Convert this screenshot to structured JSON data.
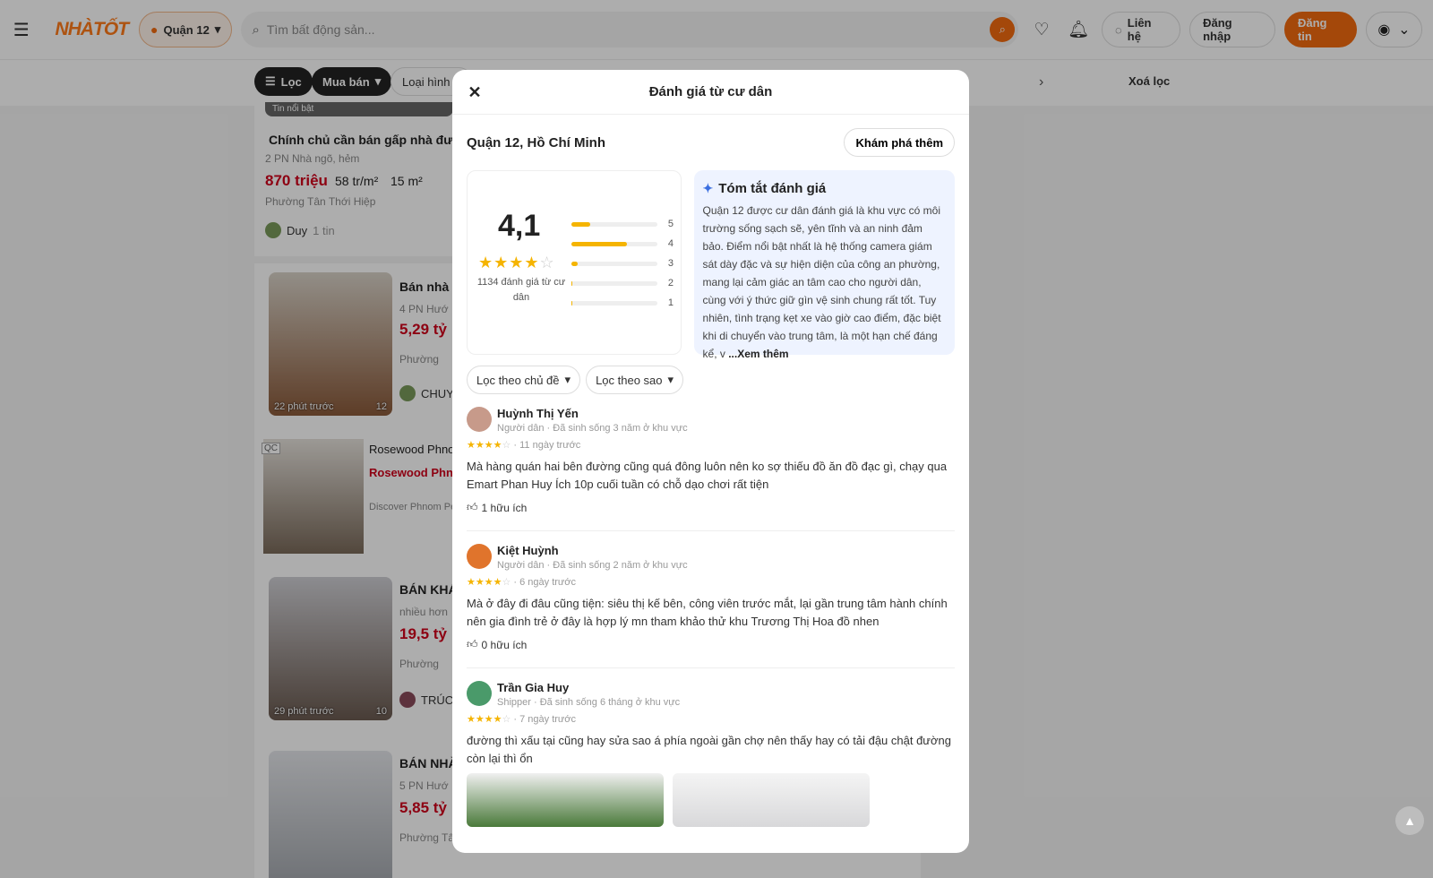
{
  "header": {
    "logo": "NHÀTỐT",
    "location": "Quận 12",
    "search_placeholder": "Tìm bất động sản...",
    "contact": "Liên hệ",
    "login": "Đăng nhập",
    "post": "Đăng tin"
  },
  "filters": {
    "filter": "Lọc",
    "type": "Mua bán",
    "category": "Loại hình B",
    "clear": "Xoá lọc"
  },
  "listings": [
    {
      "badge": "Tin nổi bật",
      "title": "Chính chủ cần bán gấp nhà đường",
      "meta": "2 PN  Nhà ngõ, hẻm",
      "price": "870 triệu",
      "ppm": "58 tr/m²",
      "area": "15 m²",
      "ward": "Phường Tân Thới Hiệp",
      "seller": "Duy",
      "seller_extra": "1 tin"
    },
    {
      "title": "Bán nhà",
      "meta": "4 PN  Hướ",
      "price": "5,29 tỷ",
      "ward": "Phường",
      "seller": "CHUY",
      "time": "22 phút trước",
      "count": "12"
    },
    {
      "ad": "QC",
      "title": "Rosewood Phno",
      "subtitle": "Rosewood Phn",
      "desc": "Discover Phnom Per"
    },
    {
      "title": "BÁN KHÁ",
      "meta": "nhiều hơn",
      "price": "19,5 tỷ",
      "ward": "Phường",
      "seller": "TRÚC",
      "time": "29 phút trước",
      "count": "10"
    },
    {
      "title": "BÁN NHÀ",
      "meta": "5 PN  Hướ",
      "price": "5,85 tỷ",
      "ward": "Phường Tân Thới Hiệp"
    }
  ],
  "modal": {
    "title": "Đánh giá từ cư dân",
    "location": "Quận 12, Hồ Chí Minh",
    "explore": "Khám phá thêm",
    "rating": "4,1",
    "rating_count": "1134 đánh giá từ cư dân",
    "bars": [
      {
        "label": "5",
        "fraction": 0.22
      },
      {
        "label": "4",
        "fraction": 0.65
      },
      {
        "label": "3",
        "fraction": 0.07
      },
      {
        "label": "2",
        "fraction": 0.01
      },
      {
        "label": "1",
        "fraction": 0.01
      }
    ],
    "summary_title": "Tóm tắt đánh giá",
    "summary_text": "Quận 12 được cư dân đánh giá là khu vực có môi trường sống sạch sẽ, yên tĩnh và an ninh đảm bảo. Điểm nổi bật nhất là hệ thống camera giám sát dày đặc và sự hiện diện của công an phường, mang lại cảm giác an tâm cao cho người dân, cùng với ý thức giữ gìn vệ sinh chung rất tốt. Tuy nhiên, tình trạng kẹt xe vào giờ cao điểm, đặc biệt khi di chuyển vào trung tâm, là một hạn chế đáng kể, v",
    "summary_more": "...Xem thêm",
    "filter_topic": "Lọc theo chủ đề",
    "filter_star": "Lọc theo sao"
  },
  "reviews": [
    {
      "name": "Huỳnh Thị Yến",
      "sub": "Người dân · Đã sinh sống 3 năm ở khu vực",
      "stars": 4,
      "time": "· 11 ngày trước",
      "text": "Mà hàng quán hai bên đường cũng quá đông luôn nên ko sợ thiếu đồ ăn đồ đạc gì, chạy qua Emart Phan Huy Ích 10p cuối tuần có chỗ dạo chơi rất tiện",
      "helpful": "1 hữu ích",
      "avatar_color": "#c79a8a"
    },
    {
      "name": "Kiệt Huỳnh",
      "sub": "Người dân · Đã sinh sống 2 năm ở khu vực",
      "stars": 4,
      "time": "· 6 ngày trước",
      "text": "Mà ở đây đi đâu cũng tiện: siêu thị kế bên, công viên trước mắt, lại gần trung tâm hành chính nên gia đình trẻ ở đây là hợp lý mn tham khảo thử khu Trương Thị Hoa đồ nhen",
      "helpful": "0 hữu ích",
      "avatar_color": "#e0742c"
    },
    {
      "name": "Trần Gia Huy",
      "sub": "Shipper · Đã sinh sống 6 tháng ở khu vực",
      "stars": 4,
      "time": "· 7 ngày trước",
      "text": "đường thì xấu tại cũng hay sửa sao á phía ngoài gần chợ nên thấy hay có tải đậu chật đường còn lại thì ổn",
      "avatar_color": "#4a9a6a"
    }
  ]
}
